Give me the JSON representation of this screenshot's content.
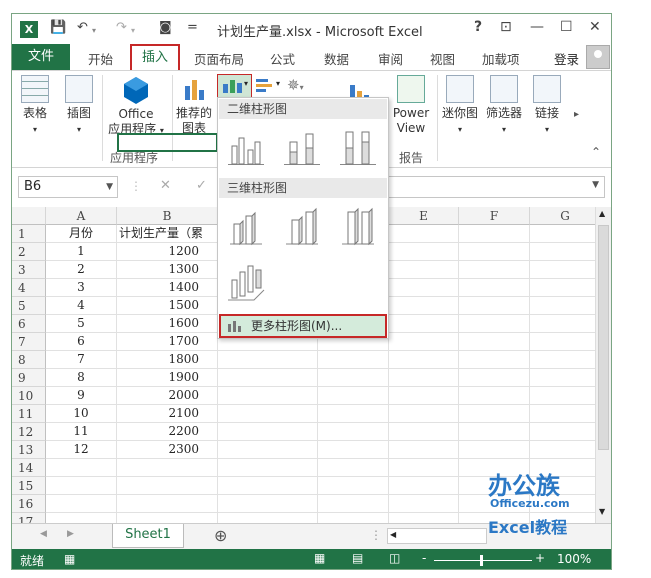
{
  "window": {
    "title": "计划生产量.xlsx - Microsoft Excel",
    "help": "?",
    "restore": "⊡",
    "minimize": "—",
    "maximize": "☐",
    "close": "✕",
    "app_icon": "X"
  },
  "qat": {
    "save_icon": "save-icon",
    "undo_icon": "undo-icon",
    "redo_icon": "redo-icon",
    "camera_icon": "camera-icon",
    "customize_icon": "="
  },
  "tabs": {
    "file": "文件",
    "home": "开始",
    "insert": "插入",
    "layout": "页面布局",
    "formulas": "公式",
    "data": "数据",
    "review": "审阅",
    "view": "视图",
    "addins": "加载项",
    "login": "登录"
  },
  "ribbon": {
    "table": "表格",
    "picture": "插图",
    "office1": "Office",
    "office2": "应用程序",
    "apps_group": "应用程序",
    "recommended1": "推荐的",
    "recommended2": "图表",
    "powerview1": "Power",
    "powerview2": "View",
    "report_group": "报告",
    "sparkline": "迷你图",
    "slicer": "筛选器",
    "link": "链接"
  },
  "formula": {
    "namebox": "B6",
    "fx": "fx",
    "cancel": "✕",
    "enter": "✓"
  },
  "columns": [
    "A",
    "B",
    "C",
    "D",
    "E",
    "F",
    "G"
  ],
  "rows": [
    "1",
    "2",
    "3",
    "4",
    "5",
    "6",
    "7",
    "8",
    "9",
    "10",
    "11",
    "12",
    "13",
    "14",
    "15",
    "16",
    "17"
  ],
  "table": {
    "header_a": "月份",
    "header_b": "计划生产量（累",
    "months": [
      "1",
      "2",
      "3",
      "4",
      "5",
      "6",
      "7",
      "8",
      "9",
      "10",
      "11",
      "12"
    ],
    "values": [
      "1200",
      "1300",
      "1400",
      "1500",
      "1600",
      "1700",
      "1800",
      "1900",
      "2000",
      "2100",
      "2200",
      "2300"
    ]
  },
  "menu": {
    "section2d": "二维柱形图",
    "section3d": "三维柱形图",
    "more": "更多柱形图(M)..."
  },
  "sheets": {
    "active": "Sheet1",
    "add": "⊕",
    "prev": "◀",
    "next": "▶"
  },
  "status": {
    "ready": "就绪",
    "zoom": "100%",
    "minus": "-",
    "plus": "+"
  },
  "watermark": {
    "line1": "办公族",
    "line2": "Officezu.com",
    "line3": "Excel教程"
  },
  "colors": {
    "accent": "#217346",
    "highlight": "#c62828"
  }
}
